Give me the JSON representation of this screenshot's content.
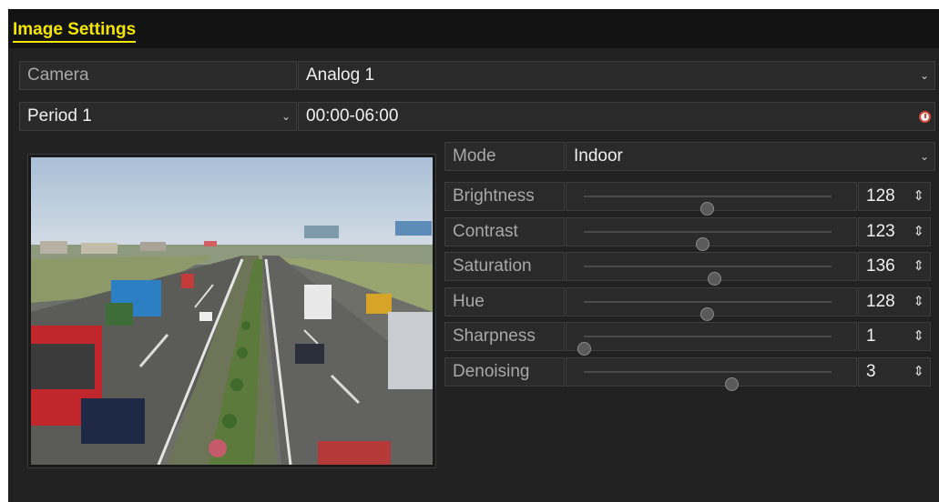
{
  "window": {
    "title": "Image Settings"
  },
  "camera": {
    "label": "Camera",
    "value": "Analog 1"
  },
  "period": {
    "value": "Period 1",
    "time": "00:00-06:00"
  },
  "mode": {
    "label": "Mode",
    "value": "Indoor"
  },
  "sliders": [
    {
      "label": "Brightness",
      "value": "128",
      "fraction": 0.5
    },
    {
      "label": "Contrast",
      "value": "123",
      "fraction": 0.48
    },
    {
      "label": "Saturation",
      "value": "136",
      "fraction": 0.53
    },
    {
      "label": "Hue",
      "value": "128",
      "fraction": 0.5
    },
    {
      "label": "Sharpness",
      "value": "1",
      "fraction": 0.004
    },
    {
      "label": "Denoising",
      "value": "3",
      "fraction": 0.6
    }
  ],
  "icons": {
    "dropdown": "chevron-down-icon",
    "time": "clock-icon",
    "spinner": "spinner-arrows-icon"
  },
  "colors": {
    "accent": "#f4e600",
    "panel": "#212121",
    "header": "#131313"
  }
}
